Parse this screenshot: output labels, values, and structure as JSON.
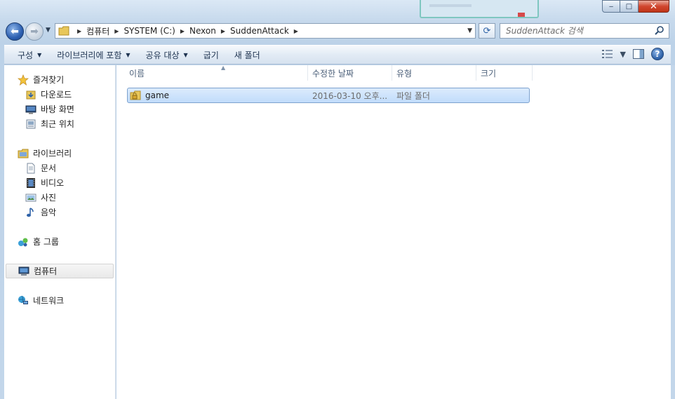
{
  "window": {
    "title": "",
    "caption_buttons": {
      "minimize": "‒",
      "maximize": "□",
      "close": "✕"
    }
  },
  "address": {
    "crumbs": [
      "컴퓨터",
      "SYSTEM (C:)",
      "Nexon",
      "SuddenAttack"
    ]
  },
  "search": {
    "placeholder": "SuddenAttack 검색"
  },
  "toolbar": {
    "organize": "구성",
    "include_in_library": "라이브러리에 포함",
    "share_with": "공유 대상",
    "burn": "굽기",
    "new_folder": "새 폴더",
    "help": "?"
  },
  "nav": {
    "favorites": {
      "label": "즐겨찾기",
      "items": [
        {
          "label": "다운로드",
          "icon": "downloads-folder-icon"
        },
        {
          "label": "바탕 화면",
          "icon": "desktop-icon"
        },
        {
          "label": "최근 위치",
          "icon": "recent-places-icon"
        }
      ]
    },
    "libraries": {
      "label": "라이브러리",
      "items": [
        {
          "label": "문서",
          "icon": "documents-icon"
        },
        {
          "label": "비디오",
          "icon": "videos-icon"
        },
        {
          "label": "사진",
          "icon": "pictures-icon"
        },
        {
          "label": "음악",
          "icon": "music-icon"
        }
      ]
    },
    "homegroup": "홈 그룹",
    "computer": "컴퓨터",
    "network": "네트워크"
  },
  "columns": [
    "이름",
    "수정한 날짜",
    "유형",
    "크기"
  ],
  "files": [
    {
      "name": "game",
      "modified": "2016-03-10 오후...",
      "type": "파일 폴더",
      "size": ""
    }
  ],
  "colors": {
    "selection": "#c1dcfb",
    "selection_border": "#7da2ce",
    "chrome": "#c6d9ec"
  }
}
